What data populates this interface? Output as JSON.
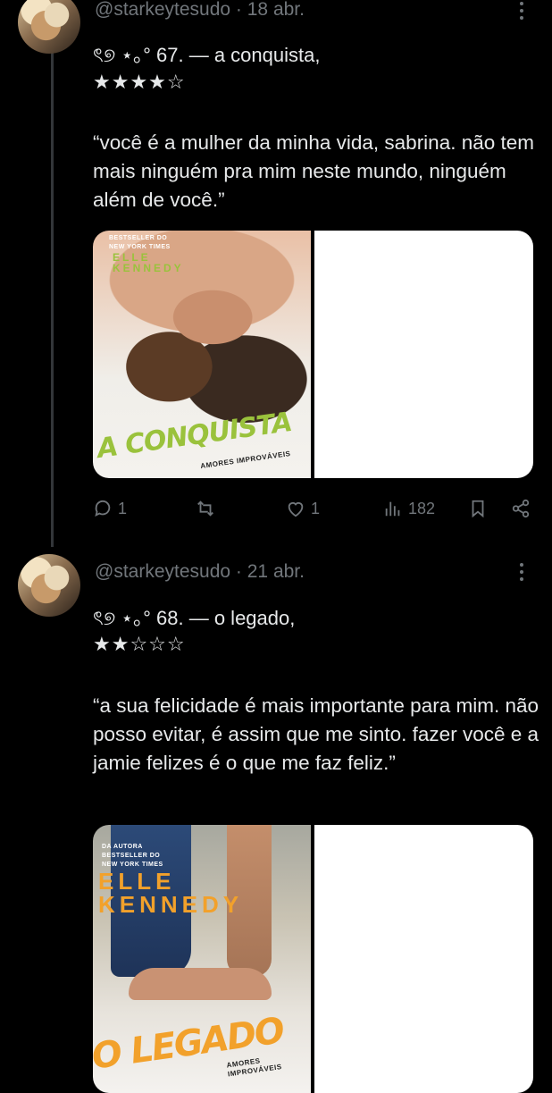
{
  "tweets": [
    {
      "handle": "@starkeytesudo",
      "separator": "·",
      "date": "18 abr.",
      "title_prefix": "ৎ୭ ⋆｡°",
      "title": "67. — a conquista,",
      "stars": "★★★★☆",
      "rating": 4,
      "quote": "“você é a mulher da minha vida, sabrina. não tem mais ninguém pra mim neste mundo, ninguém além de você.”",
      "cover": {
        "top_text": "BESTSELLER DO\nNEW YORK TIMES",
        "author": "ELLE\nKENNEDY",
        "book_title": "A CONQUISTA",
        "series": "AMORES IMPROVÁVEIS"
      },
      "stats": {
        "replies": "1",
        "reposts": "",
        "likes": "1",
        "views": "182"
      }
    },
    {
      "handle": "@starkeytesudo",
      "separator": "·",
      "date": "21 abr.",
      "title_prefix": "ৎ୭ ⋆｡°",
      "title": "68. — o legado,",
      "stars": "★★☆☆☆",
      "rating": 2,
      "quote": "“a sua felicidade é mais importante para mim. não posso evitar, é assim que me sinto. fazer você e a jamie felizes é o que me faz feliz.”",
      "cover": {
        "top_text": "DA AUTORA\nBESTSELLER DO\nNEW YORK TIMES",
        "author": "ELLE\nKENNEDY",
        "book_title": "O LEGADO",
        "series": "AMORES IMPROVÁVEIS"
      }
    }
  ],
  "colors": {
    "background": "#000000",
    "text": "#e7e9ea",
    "muted": "#71767b",
    "cover_accent_green": "#9ac23c",
    "cover_accent_orange": "#f2a12b"
  },
  "icons": [
    "more-icon",
    "reply-icon",
    "repost-icon",
    "like-icon",
    "views-icon",
    "bookmark-icon",
    "share-icon"
  ]
}
